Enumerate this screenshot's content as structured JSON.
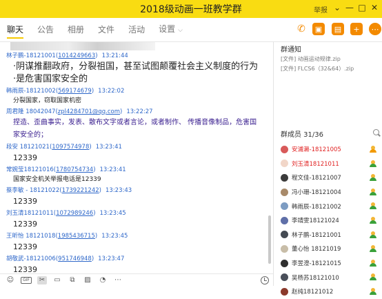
{
  "window": {
    "title": "2018级动画一班教学群",
    "report_label": "举报",
    "controls": {
      "minimize": "—",
      "maximize": "□",
      "close": "✕"
    }
  },
  "tabs": [
    {
      "label": "聊天",
      "active": true
    },
    {
      "label": "公告",
      "active": false
    },
    {
      "label": "相册",
      "active": false
    },
    {
      "label": "文件",
      "active": false
    },
    {
      "label": "活动",
      "active": false
    },
    {
      "label": "设置",
      "active": false
    }
  ],
  "toolbar_icons": [
    {
      "name": "phone-icon",
      "color": "#f38a00",
      "glyph": "✆"
    },
    {
      "name": "video-icon",
      "color": "#f38a00",
      "glyph": "▣"
    },
    {
      "name": "screen-share-icon",
      "color": "#f38a00",
      "glyph": "▤"
    },
    {
      "name": "add-app-icon",
      "color": "#f38a00",
      "glyph": "+"
    },
    {
      "name": "more-icon",
      "color": "#f38a00",
      "glyph": "⋯"
    }
  ],
  "messages": [
    {
      "sender": "林子鹏-18121001",
      "qq": "1014249663",
      "time": "13:21:44",
      "lines": [
        "·阴谋推翻政府，分裂祖国，甚至试图颠覆社会主义制度的行为",
        "·是危害国家安全的"
      ],
      "style": "big"
    },
    {
      "sender": "韩雨辰-18121002",
      "qq": "569174679",
      "time": "13:22:02",
      "lines": [
        "分裂国家，窃取国家机密"
      ],
      "style": "small"
    },
    {
      "sender": "周君隆 18042047",
      "qq": "zpl4284701@qq.com",
      "time": "13:22:27",
      "lines": [
        "捏造、歪曲事实，发表、散布文字或者言论，或者制作、 传播音像制品，危害国家安全的；"
      ],
      "style": "purple"
    },
    {
      "sender": "段安 18121021",
      "qq": "1097574978",
      "time": "13:23:41",
      "lines": [
        "12339"
      ],
      "style": "mid"
    },
    {
      "sender": "常婉莹18121016",
      "qq": "1780754734",
      "time": "13:23:41",
      "lines": [
        "国家安全机关举报电话是12339"
      ],
      "style": "small"
    },
    {
      "sender": "蔡李敏 - 18121022",
      "qq": "1739221242",
      "time": "13:23:43",
      "lines": [
        "12339"
      ],
      "style": "mid"
    },
    {
      "sender": "刘玉清18121011",
      "qq": "1072989246",
      "time": "13:23:45",
      "lines": [
        "12339"
      ],
      "style": "mid"
    },
    {
      "sender": "王昕怡 18121018",
      "qq": "1985436715",
      "time": "13:23:45",
      "lines": [
        "12339"
      ],
      "style": "mid"
    },
    {
      "sender": "胡敬武-18121006",
      "qq": "951746948",
      "time": "13:23:47",
      "lines": [
        "12339"
      ],
      "style": "mid"
    }
  ],
  "composer_tools": [
    {
      "name": "emoji-icon",
      "glyph": "☺"
    },
    {
      "name": "gif-icon",
      "glyph": "GIF"
    },
    {
      "name": "scissors-icon",
      "glyph": "✂"
    },
    {
      "name": "folder-icon",
      "glyph": "▭"
    },
    {
      "name": "copy-icon",
      "glyph": "⧉"
    },
    {
      "name": "image-icon",
      "glyph": "▨"
    },
    {
      "name": "mute-bell-icon",
      "glyph": "◔"
    },
    {
      "name": "more-tools-icon",
      "glyph": "⋯"
    }
  ],
  "notice": {
    "title": "群通知",
    "files": [
      "[文件] 动画运动规律.zip",
      "[文件] FLCS6（32&64）.zip"
    ]
  },
  "members": {
    "header": "群成员 31/36",
    "list": [
      {
        "name": "安浦濑-18121005",
        "red": true,
        "avatar": "#d85a5a",
        "owner": true
      },
      {
        "name": "刘玉清18121011",
        "red": true,
        "avatar": "#f1d6c8",
        "owner": false
      },
      {
        "name": "程文佳-18121007",
        "red": false,
        "avatar": "#3b3b3b",
        "owner": false
      },
      {
        "name": "冯小珊-18121004",
        "red": false,
        "avatar": "#a88a6a",
        "owner": false
      },
      {
        "name": "韩雨辰-18121002",
        "red": false,
        "avatar": "#7d9cc2",
        "owner": false
      },
      {
        "name": "李靖雯18121024",
        "red": false,
        "avatar": "#5f6fa8",
        "owner": false
      },
      {
        "name": "林子鹏-18121001",
        "red": false,
        "avatar": "#444a52",
        "owner": false
      },
      {
        "name": "董心怡 18121019",
        "red": false,
        "avatar": "#c8bda8",
        "owner": false
      },
      {
        "name": "李昱澄-18121015",
        "red": false,
        "avatar": "#2f2f2f",
        "owner": false
      },
      {
        "name": "吴杨苏18121010",
        "red": false,
        "avatar": "#4a4f5a",
        "owner": false
      },
      {
        "name": "赵纯18121012",
        "red": false,
        "avatar": "#8b3a2b",
        "owner": false
      }
    ]
  }
}
